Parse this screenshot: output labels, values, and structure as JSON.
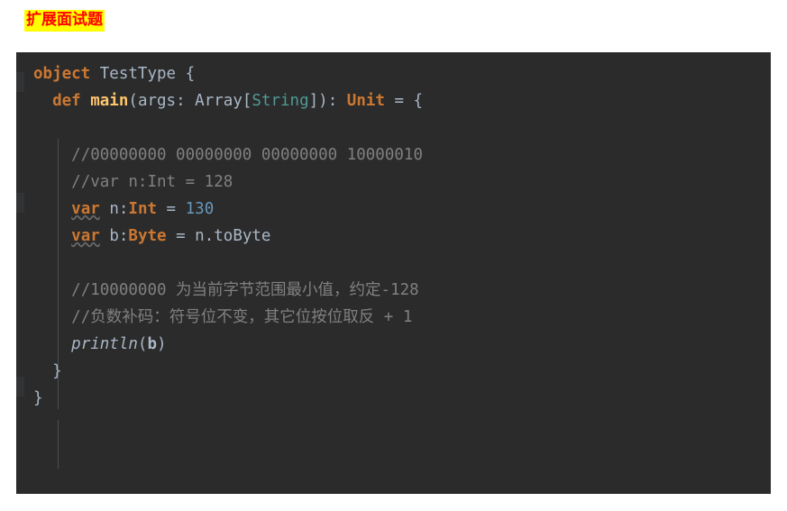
{
  "heading": {
    "text": "扩展面试题",
    "text_color": "#ff0000",
    "highlight_color": "#ffff00"
  },
  "editor": {
    "background": "#2b2b2b",
    "gutter_background": "#313335",
    "language": "scala",
    "theme_colors": {
      "keyword": "#cc7832",
      "identifier": "#a9b7c6",
      "function": "#ffc66d",
      "string_type": "#4e9a96",
      "number": "#6897bb",
      "comment": "#808080"
    },
    "lines": [
      {
        "n": 1,
        "tokens": [
          {
            "t": "object",
            "c": "kw"
          },
          {
            "t": " ",
            "c": "plain"
          },
          {
            "t": "TestType",
            "c": "cls"
          },
          {
            "t": " ",
            "c": "plain"
          },
          {
            "t": "{",
            "c": "punct"
          }
        ]
      },
      {
        "n": 2,
        "indent": 1,
        "tokens": [
          {
            "t": "def",
            "c": "kw"
          },
          {
            "t": " ",
            "c": "plain"
          },
          {
            "t": "main",
            "c": "fn"
          },
          {
            "t": "(",
            "c": "punct"
          },
          {
            "t": "args",
            "c": "plain"
          },
          {
            "t": ": ",
            "c": "punct"
          },
          {
            "t": "Array",
            "c": "cls"
          },
          {
            "t": "[",
            "c": "punct"
          },
          {
            "t": "String",
            "c": "strtype"
          },
          {
            "t": "])",
            "c": "punct"
          },
          {
            "t": ": ",
            "c": "punct"
          },
          {
            "t": "Unit",
            "c": "type"
          },
          {
            "t": " = ",
            "c": "punct"
          },
          {
            "t": "{",
            "c": "punct"
          }
        ]
      },
      {
        "n": 3,
        "indent": 2,
        "tokens": []
      },
      {
        "n": 4,
        "indent": 2,
        "tokens": [
          {
            "t": "//00000000 00000000 00000000 10000010",
            "c": "cmt"
          }
        ]
      },
      {
        "n": 5,
        "indent": 2,
        "tokens": [
          {
            "t": "//var n:Int = 128",
            "c": "cmt"
          }
        ]
      },
      {
        "n": 6,
        "indent": 2,
        "tokens": [
          {
            "t": "var",
            "c": "kw-u"
          },
          {
            "t": " ",
            "c": "plain"
          },
          {
            "t": "n",
            "c": "plain"
          },
          {
            "t": ":",
            "c": "punct"
          },
          {
            "t": "Int",
            "c": "type"
          },
          {
            "t": " = ",
            "c": "punct"
          },
          {
            "t": "130",
            "c": "num"
          }
        ]
      },
      {
        "n": 7,
        "indent": 2,
        "tokens": [
          {
            "t": "var",
            "c": "kw-u"
          },
          {
            "t": " ",
            "c": "plain"
          },
          {
            "t": "b",
            "c": "plain"
          },
          {
            "t": ":",
            "c": "punct"
          },
          {
            "t": "Byte",
            "c": "type"
          },
          {
            "t": " = ",
            "c": "punct"
          },
          {
            "t": "n.toByte",
            "c": "plain"
          }
        ]
      },
      {
        "n": 8,
        "indent": 2,
        "tokens": []
      },
      {
        "n": 9,
        "indent": 2,
        "tokens": [
          {
            "t": "//10000000 为当前字节范围最小值，约定-128",
            "c": "cmt"
          }
        ]
      },
      {
        "n": 10,
        "indent": 2,
        "tokens": [
          {
            "t": "//负数补码：符号位不变，其它位按位取反 + 1",
            "c": "cmt"
          }
        ]
      },
      {
        "n": 11,
        "indent": 2,
        "tokens": [
          {
            "t": "println",
            "c": "mth"
          },
          {
            "t": "(",
            "c": "punct"
          },
          {
            "t": "b",
            "c": "fieldb"
          },
          {
            "t": ")",
            "c": "punct"
          }
        ]
      },
      {
        "n": 12,
        "indent": 1,
        "tokens": [
          {
            "t": "}",
            "c": "punct"
          }
        ]
      },
      {
        "n": 13,
        "indent": 0,
        "tokens": [
          {
            "t": "}",
            "c": "punct"
          }
        ]
      }
    ]
  }
}
